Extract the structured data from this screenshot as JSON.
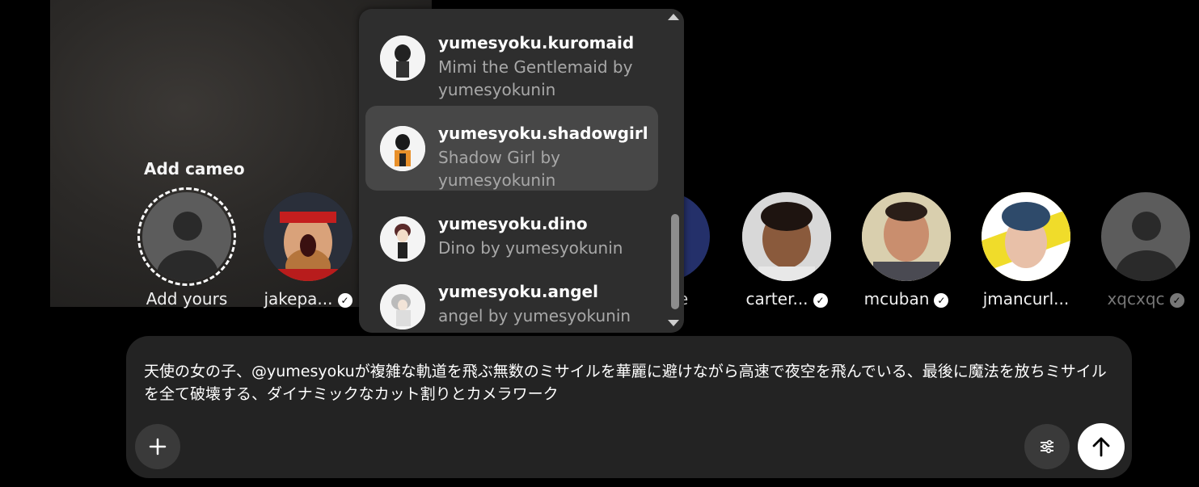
{
  "cameo_section": {
    "title": "Add cameo",
    "items": [
      {
        "label": "Add yours",
        "verified": false
      },
      {
        "label": "jakepa...",
        "verified": true
      },
      {
        "label": "ke",
        "verified": false
      },
      {
        "label": "carter...",
        "verified": true
      },
      {
        "label": "mcuban",
        "verified": true
      },
      {
        "label": "jmancurl...",
        "verified": false
      },
      {
        "label": "xqcxqc",
        "verified": true
      }
    ]
  },
  "mention_dropdown": {
    "items": [
      {
        "name": "yumesyoku.kuromaid",
        "description": "Mimi the Gentlemaid by yumesyokunin",
        "highlighted": false
      },
      {
        "name": "yumesyoku.shadowgirl",
        "description": "Shadow Girl by yumesyokunin",
        "highlighted": true
      },
      {
        "name": "yumesyoku.dino",
        "description": "Dino by yumesyokunin",
        "highlighted": false
      },
      {
        "name": "yumesyoku.angel",
        "description": "angel by yumesyokunin",
        "highlighted": false
      }
    ]
  },
  "composer": {
    "prompt": "天使の女の子、@yumesyokuが複雑な軌道を飛ぶ無数のミサイルを華麗に避けながら高速で夜空を飛んでいる、最後に魔法を放ちミサイルを全て破壊する、ダイナミックなカット割りとカメラワーク",
    "add_icon": "plus-icon",
    "settings_icon": "sliders-icon",
    "send_icon": "arrow-up-icon"
  },
  "colors": {
    "background": "#000000",
    "panel": "#2e2e2e",
    "highlight": "#474747",
    "composer": "#232323",
    "muted_text": "#a8a8a8"
  }
}
